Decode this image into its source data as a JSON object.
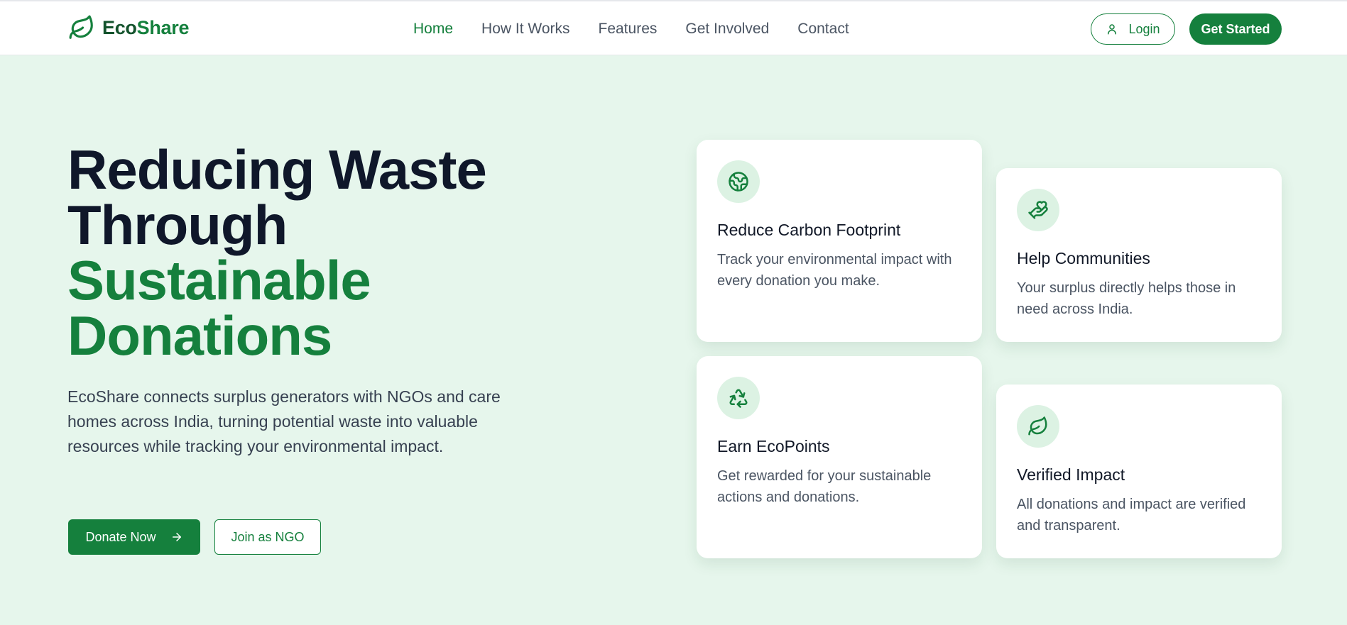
{
  "brand": {
    "name_part1": "Eco",
    "name_part2": "Share",
    "logo_icon": "leaf-icon"
  },
  "nav": {
    "items": [
      {
        "label": "Home",
        "active": true
      },
      {
        "label": "How It Works",
        "active": false
      },
      {
        "label": "Features",
        "active": false
      },
      {
        "label": "Get Involved",
        "active": false
      },
      {
        "label": "Contact",
        "active": false
      }
    ]
  },
  "auth": {
    "login_label": "Login",
    "login_icon": "user-icon",
    "get_started_label": "Get Started"
  },
  "hero": {
    "title_line1": "Reducing Waste",
    "title_line2": "Through",
    "title_line3": "Sustainable",
    "title_line4": "Donations",
    "description": "EcoShare connects surplus generators with NGOs and care homes across India, turning potential waste into valuable resources while tracking your environmental impact.",
    "donate_label": "Donate Now",
    "donate_icon": "arrow-right-icon",
    "ngo_label": "Join as NGO"
  },
  "features": [
    {
      "icon": "globe-icon",
      "title": "Reduce Carbon Footprint",
      "description": "Track your environmental impact with every donation you make."
    },
    {
      "icon": "hand-heart-icon",
      "title": "Help Communities",
      "description": "Your surplus directly helps those in need across India."
    },
    {
      "icon": "recycle-icon",
      "title": "Earn EcoPoints",
      "description": "Get rewarded for your sustainable actions and donations."
    },
    {
      "icon": "leaf-icon",
      "title": "Verified Impact",
      "description": "All donations and impact are verified and transparent."
    }
  ],
  "colors": {
    "primary": "#15803d",
    "primary_dark": "#14532d",
    "hero_background": "#e6f6ec",
    "icon_background": "#dcf2e3",
    "heading_dark": "#0f172a"
  }
}
